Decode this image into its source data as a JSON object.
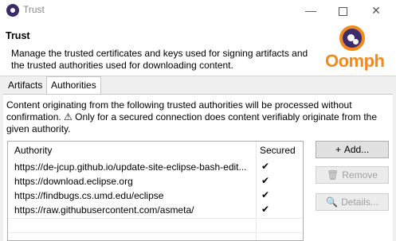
{
  "window": {
    "title": "Trust"
  },
  "header": {
    "title": "Trust",
    "description": "Manage the trusted certificates and keys used for signing artifacts and the trusted authorities used for downloading content.",
    "logo_text": "Oomph"
  },
  "tabs": [
    {
      "label": "Artifacts",
      "selected": false
    },
    {
      "label": "Authorities",
      "selected": true
    }
  ],
  "info_text": "Content originating from the following trusted authorities will be processed without confirmation. ⚠ Only for a secured connection does content verifiably originate from the given authority.",
  "table": {
    "columns": [
      "Authority",
      "Secured"
    ],
    "rows": [
      {
        "authority": "https://de-jcup.github.io/update-site-eclipse-bash-edit...",
        "secured": "✔"
      },
      {
        "authority": "https://download.eclipse.org",
        "secured": "✔"
      },
      {
        "authority": "https://findbugs.cs.umd.edu/eclipse",
        "secured": "✔"
      },
      {
        "authority": "https://raw.githubusercontent.com/asmeta/",
        "secured": "✔"
      }
    ]
  },
  "buttons": {
    "add": "Add...",
    "remove": "Remove",
    "details": "Details..."
  },
  "colors": {
    "logo_orange": "#f28a1c",
    "logo_purple": "#3d2c6b"
  }
}
